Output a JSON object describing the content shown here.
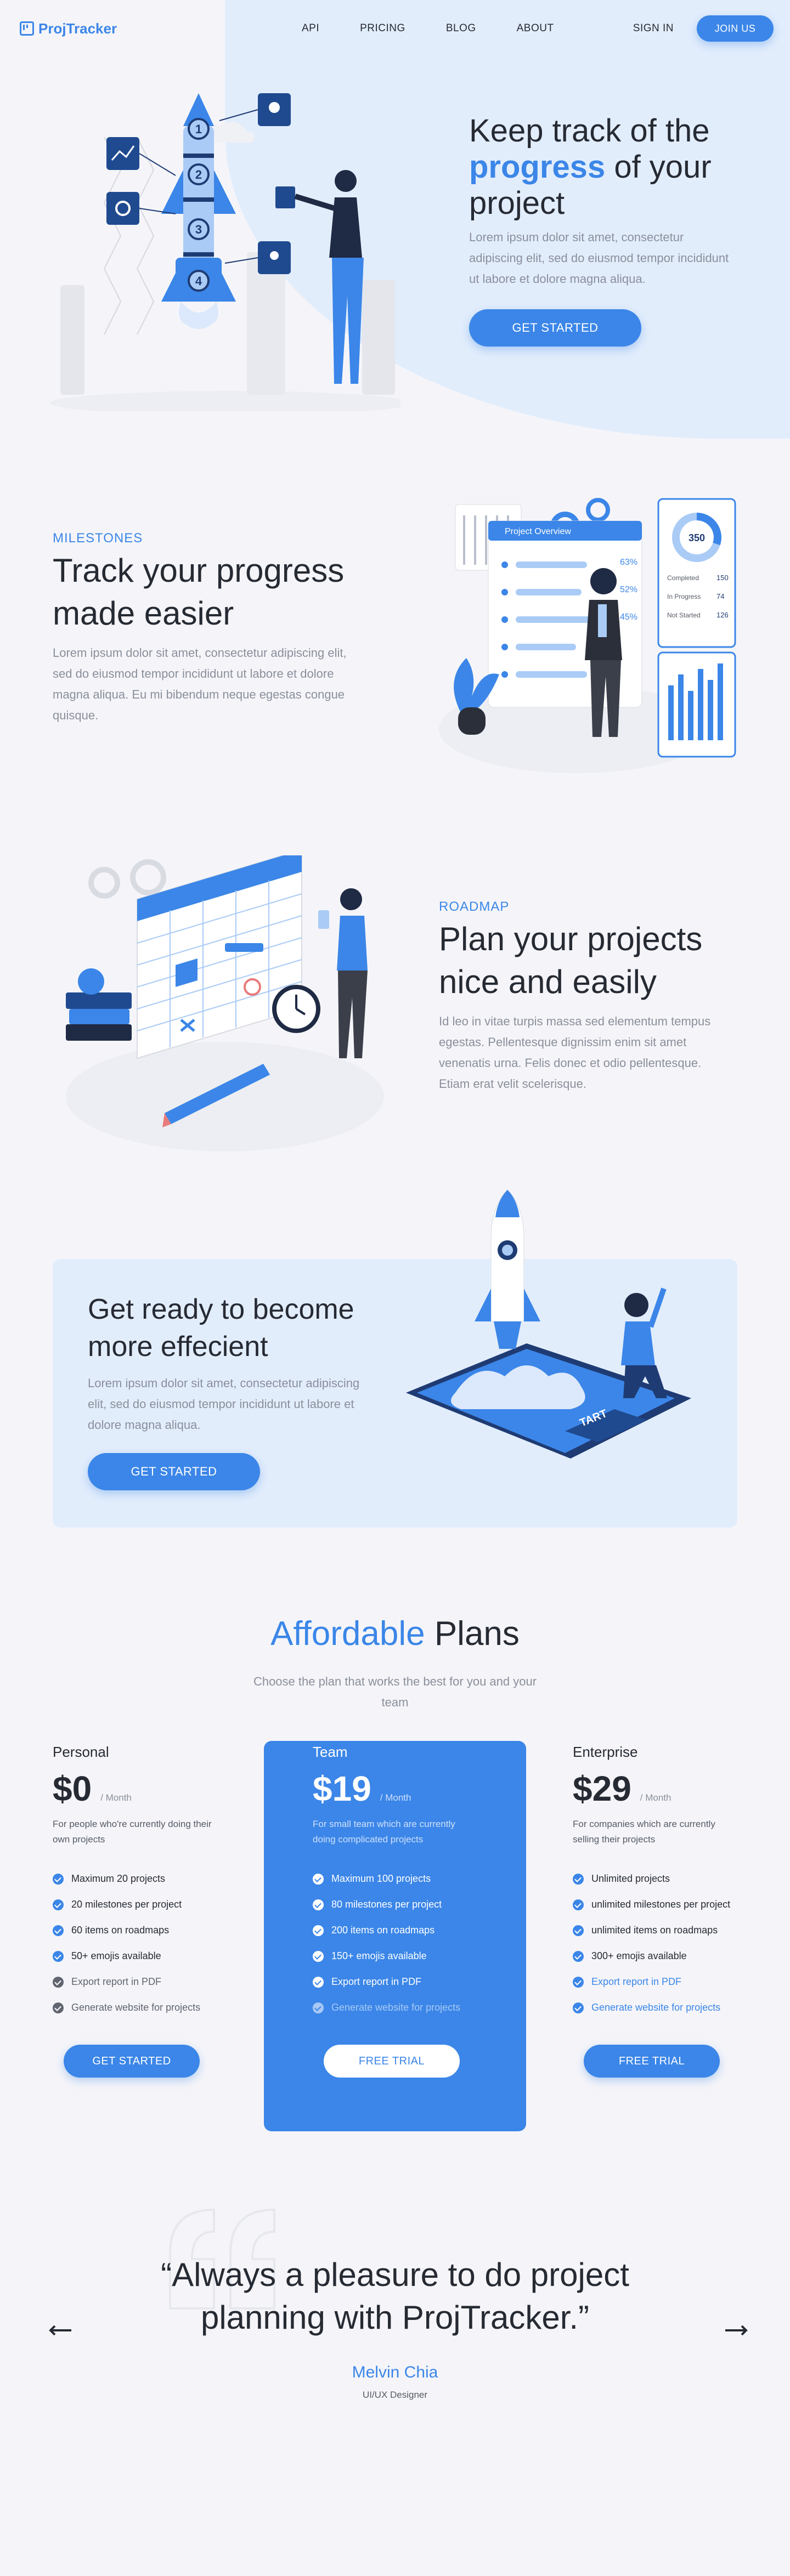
{
  "nav": {
    "brand": "ProjTracker",
    "links": [
      "API",
      "PRICING",
      "BLOG",
      "ABOUT"
    ],
    "signin": "SIGN IN",
    "join": "JOIN US"
  },
  "hero": {
    "title_line1": "Keep track of the",
    "title_accent": "progress",
    "title_rest": " of your",
    "title_line3": "project",
    "body": "Lorem ipsum dolor sit amet, consectetur adipiscing elit, sed do eiusmod tempor incididunt ut labore et dolore magna aliqua.",
    "cta": "GET STARTED",
    "rocket_steps": [
      "1",
      "2",
      "3",
      "4"
    ]
  },
  "milestones": {
    "eyebrow": "MILESTONES",
    "title_line1": "Track your progress",
    "title_line2": "made easier",
    "body": "Lorem ipsum dolor sit amet, consectetur adipiscing elit, sed do eiusmod tempor incididunt ut labore et dolore magna aliqua. Eu mi bibendum neque egestas congue quisque.",
    "dashboard": {
      "header": "Project Overview",
      "donut_value": "350",
      "stats": [
        {
          "label": "Completed",
          "value": "150"
        },
        {
          "label": "In Progress",
          "value": "74"
        },
        {
          "label": "Not Started",
          "value": "126"
        }
      ],
      "row_values": [
        "63%",
        "52%",
        "45%"
      ]
    }
  },
  "roadmap": {
    "eyebrow": "ROADMAP",
    "title_line1": "Plan your projects",
    "title_line2": "nice and easily",
    "body": "Id leo in vitae turpis massa sed elementum tempus egestas. Pellentesque dignissim enim sit amet venenatis urna. Felis donec et odio pellentesque. Etiam erat velit scelerisque."
  },
  "cta": {
    "title_line1": "Get ready to become",
    "title_line2": "more effecient",
    "body": "Lorem ipsum dolor sit amet, consectetur adipiscing elit, sed do eiusmod tempor incididunt ut labore et dolore magna aliqua.",
    "button": "GET STARTED",
    "launch_key": "TART"
  },
  "pricing": {
    "title_accent": "Affordable",
    "title_rest": " Plans",
    "subtitle": "Choose the plan that works the best for you and your team",
    "plans": [
      {
        "name": "Personal",
        "price": "$0",
        "per": "/ Month",
        "desc": "For people who're currently doing their own projects",
        "features": [
          "Maximum 20 projects",
          "20 milestones per project",
          "60 items on roadmaps",
          "50+ emojis available",
          "Export report in PDF",
          "Generate website for projects"
        ],
        "button": "GET STARTED"
      },
      {
        "name": "Team",
        "price": "$19",
        "per": "/ Month",
        "desc": "For small team which are currently doing complicated projects",
        "features": [
          "Maximum 100 projects",
          "80 milestones per project",
          "200 items on roadmaps",
          "150+ emojis available",
          "Export report in PDF",
          "Generate website for projects"
        ],
        "button": "FREE TRIAL"
      },
      {
        "name": "Enterprise",
        "price": "$29",
        "per": "/ Month",
        "desc": "For companies which are currently selling their projects",
        "features": [
          "Unlimited projects",
          "unlimited milestones per project",
          "unlimited items on roadmaps",
          "300+ emojis available",
          "Export report in PDF",
          "Generate website for projects"
        ],
        "button": "FREE TRIAL"
      }
    ]
  },
  "testimonial": {
    "quote_line1": "“Always a pleasure to do project",
    "quote_line2": "planning with ProjTracker.”",
    "name": "Melvin Chia",
    "role": "UI/UX Designer"
  },
  "colors": {
    "accent": "#3b86e8",
    "hero_bg": "#e2edfc",
    "text": "#262a33",
    "muted": "#8a8f9b"
  }
}
